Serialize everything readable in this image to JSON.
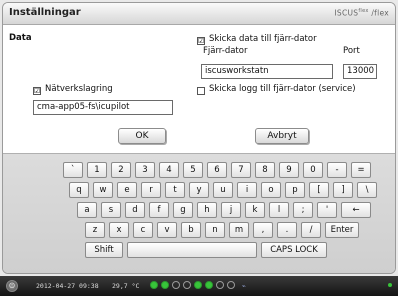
{
  "window": {
    "title": "Inställningar",
    "brand": "ISCUS",
    "brand_sup": "flex",
    "brand_suffix": "/flex"
  },
  "data_section": {
    "title": "Data",
    "network_storage": {
      "label": "Nätverkslagring",
      "checked": true,
      "path": "cma-app05-fs\\icupilot"
    },
    "send_to_remote": {
      "label": "Skicka data till fjärr-dator",
      "checked": true
    },
    "remote_computer": {
      "label": "Fjärr-dator",
      "value": "iscusworkstatn"
    },
    "port": {
      "label": "Port",
      "value": "13000"
    },
    "send_log": {
      "label": "Skicka logg till fjärr-dator (service)",
      "checked": false
    }
  },
  "buttons": {
    "ok": "OK",
    "cancel": "Avbryt"
  },
  "keyboard": {
    "row1": [
      "`",
      "1",
      "2",
      "3",
      "4",
      "5",
      "6",
      "7",
      "8",
      "9",
      "0",
      "-",
      "="
    ],
    "row2": [
      "q",
      "w",
      "e",
      "r",
      "t",
      "y",
      "u",
      "i",
      "o",
      "p",
      "[",
      "]",
      "\\"
    ],
    "row3": [
      "a",
      "s",
      "d",
      "f",
      "g",
      "h",
      "j",
      "k",
      "l",
      ";",
      "'"
    ],
    "backspace": "←",
    "row4": [
      "z",
      "x",
      "c",
      "v",
      "b",
      "n",
      "m",
      ",",
      ".",
      "/"
    ],
    "enter": "Enter",
    "shift": "Shift",
    "space": "",
    "caps": "CAPS LOCK"
  },
  "taskbar": {
    "datetime": "2012-04-27 09:38",
    "temperature": "29,7 °C",
    "status_dots": [
      true,
      true,
      false,
      false,
      true,
      true,
      false,
      false
    ]
  },
  "colors": {
    "status_on": "#38c43a"
  }
}
